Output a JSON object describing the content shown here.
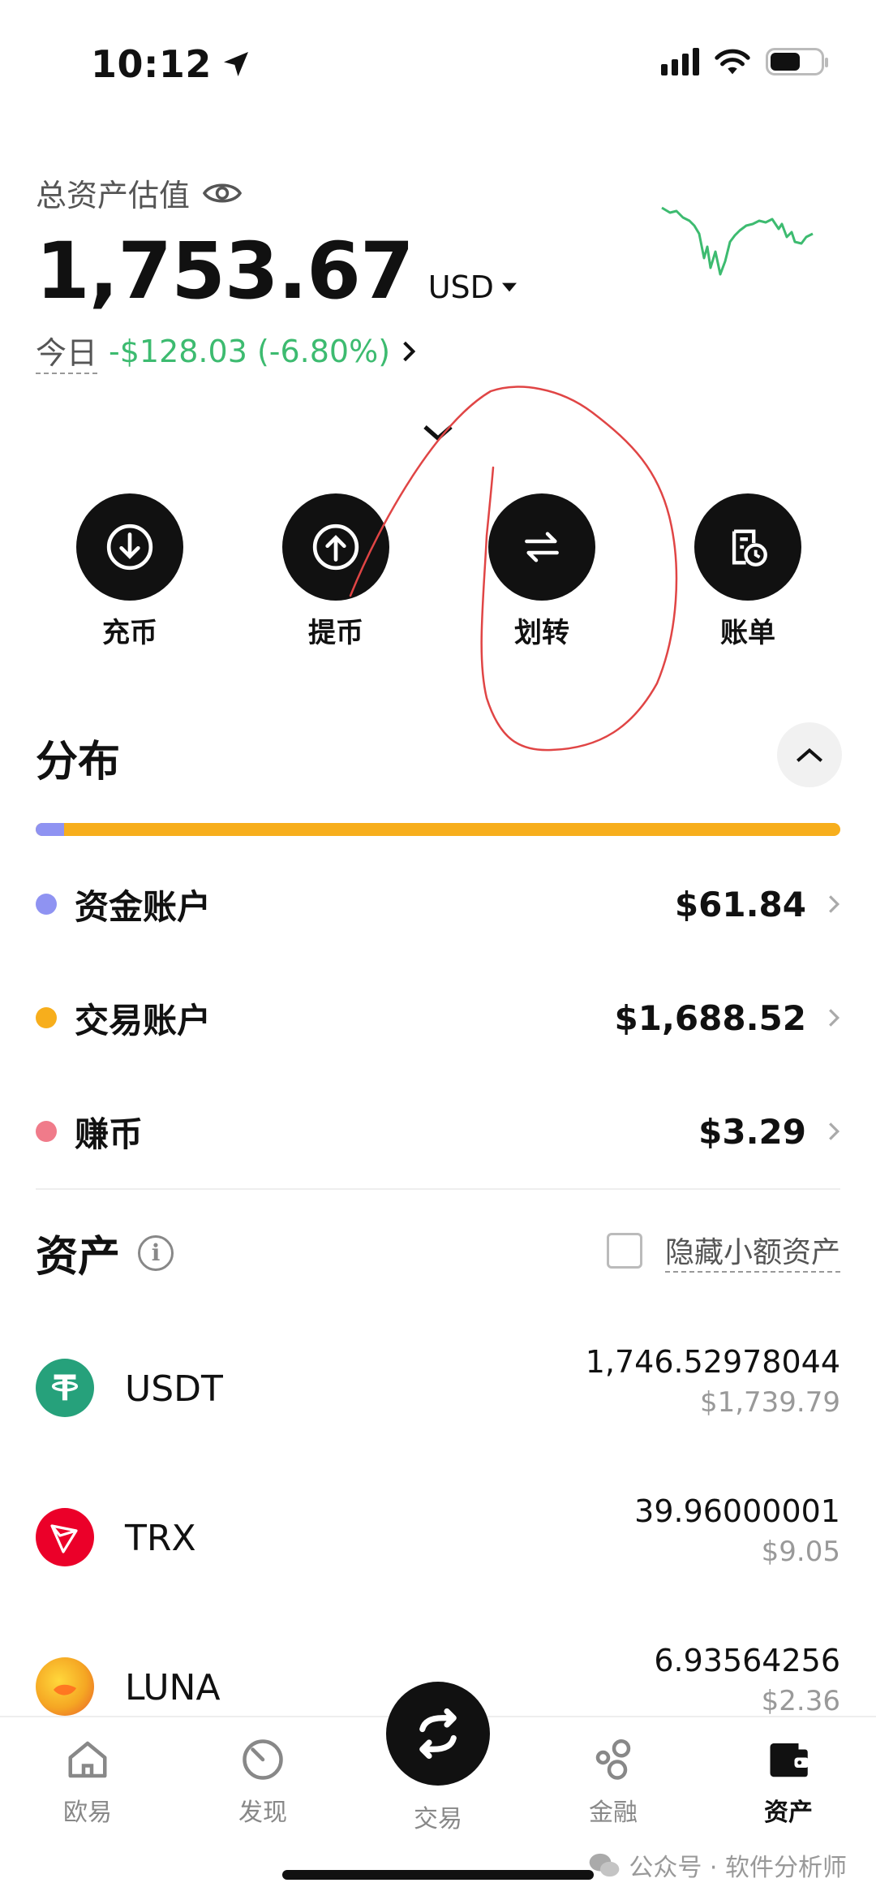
{
  "status_bar": {
    "time": "10:12"
  },
  "header": {
    "total_label": "总资产估值",
    "total_value": "1,753.67",
    "currency": "USD",
    "today_label": "今日",
    "today_pnl": "-$128.03 (-6.80%)",
    "pnl_color": "#3dbb70"
  },
  "actions": [
    {
      "label": "充币",
      "icon": "deposit-icon"
    },
    {
      "label": "提币",
      "icon": "withdraw-icon"
    },
    {
      "label": "划转",
      "icon": "transfer-icon"
    },
    {
      "label": "账单",
      "icon": "bill-icon"
    }
  ],
  "distribution": {
    "title": "分布",
    "accounts": [
      {
        "name": "资金账户",
        "amount": "$61.84",
        "color": "#8f93f2"
      },
      {
        "name": "交易账户",
        "amount": "$1,688.52",
        "color": "#f7ae1c"
      },
      {
        "name": "赚币",
        "amount": "$3.29",
        "color": "#f07b8a"
      }
    ]
  },
  "assets": {
    "title": "资产",
    "hide_small_label": "隐藏小额资产",
    "items": [
      {
        "symbol": "USDT",
        "quantity": "1,746.52978044",
        "usd_value": "$1,739.79",
        "logo": "usdt-logo-icon"
      },
      {
        "symbol": "TRX",
        "quantity": "39.96000001",
        "usd_value": "$9.05",
        "logo": "trx-logo-icon"
      },
      {
        "symbol": "LUNA",
        "quantity": "6.93564256",
        "usd_value": "$2.36",
        "logo": "luna-logo-icon"
      }
    ]
  },
  "bottom_nav": {
    "items": [
      {
        "label": "欧易",
        "icon": "home-icon"
      },
      {
        "label": "发现",
        "icon": "discover-icon"
      },
      {
        "label": "交易",
        "icon": "trade-icon"
      },
      {
        "label": "金融",
        "icon": "finance-icon"
      },
      {
        "label": "资产",
        "icon": "wallet-icon"
      }
    ],
    "active": "资产"
  },
  "watermark": "公众号 · 软件分析师"
}
